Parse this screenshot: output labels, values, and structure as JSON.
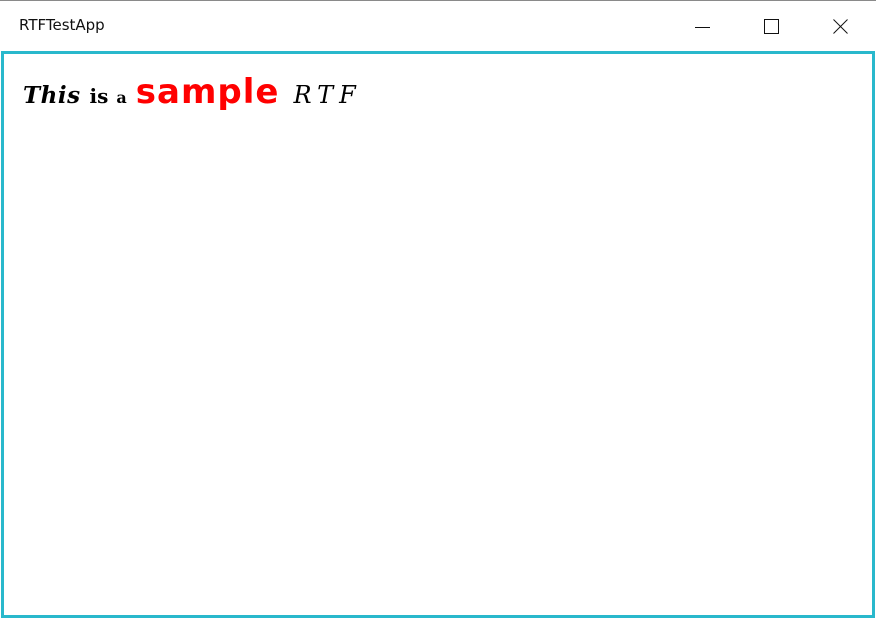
{
  "window": {
    "title": "RTFTestApp",
    "controls": {
      "minimize": "minimize-icon",
      "maximize": "maximize-icon",
      "close": "close-icon"
    }
  },
  "rtf": {
    "words": [
      {
        "text": "This",
        "color": "#000000"
      },
      {
        "text": "is",
        "color": "#000000"
      },
      {
        "text": "a",
        "color": "#000000"
      },
      {
        "text": "sample",
        "color": "#ff0000"
      },
      {
        "text": "RTF",
        "color": "#000000"
      }
    ]
  },
  "colors": {
    "focus_border": "#29b8cc",
    "highlight_text": "#ff0000"
  }
}
